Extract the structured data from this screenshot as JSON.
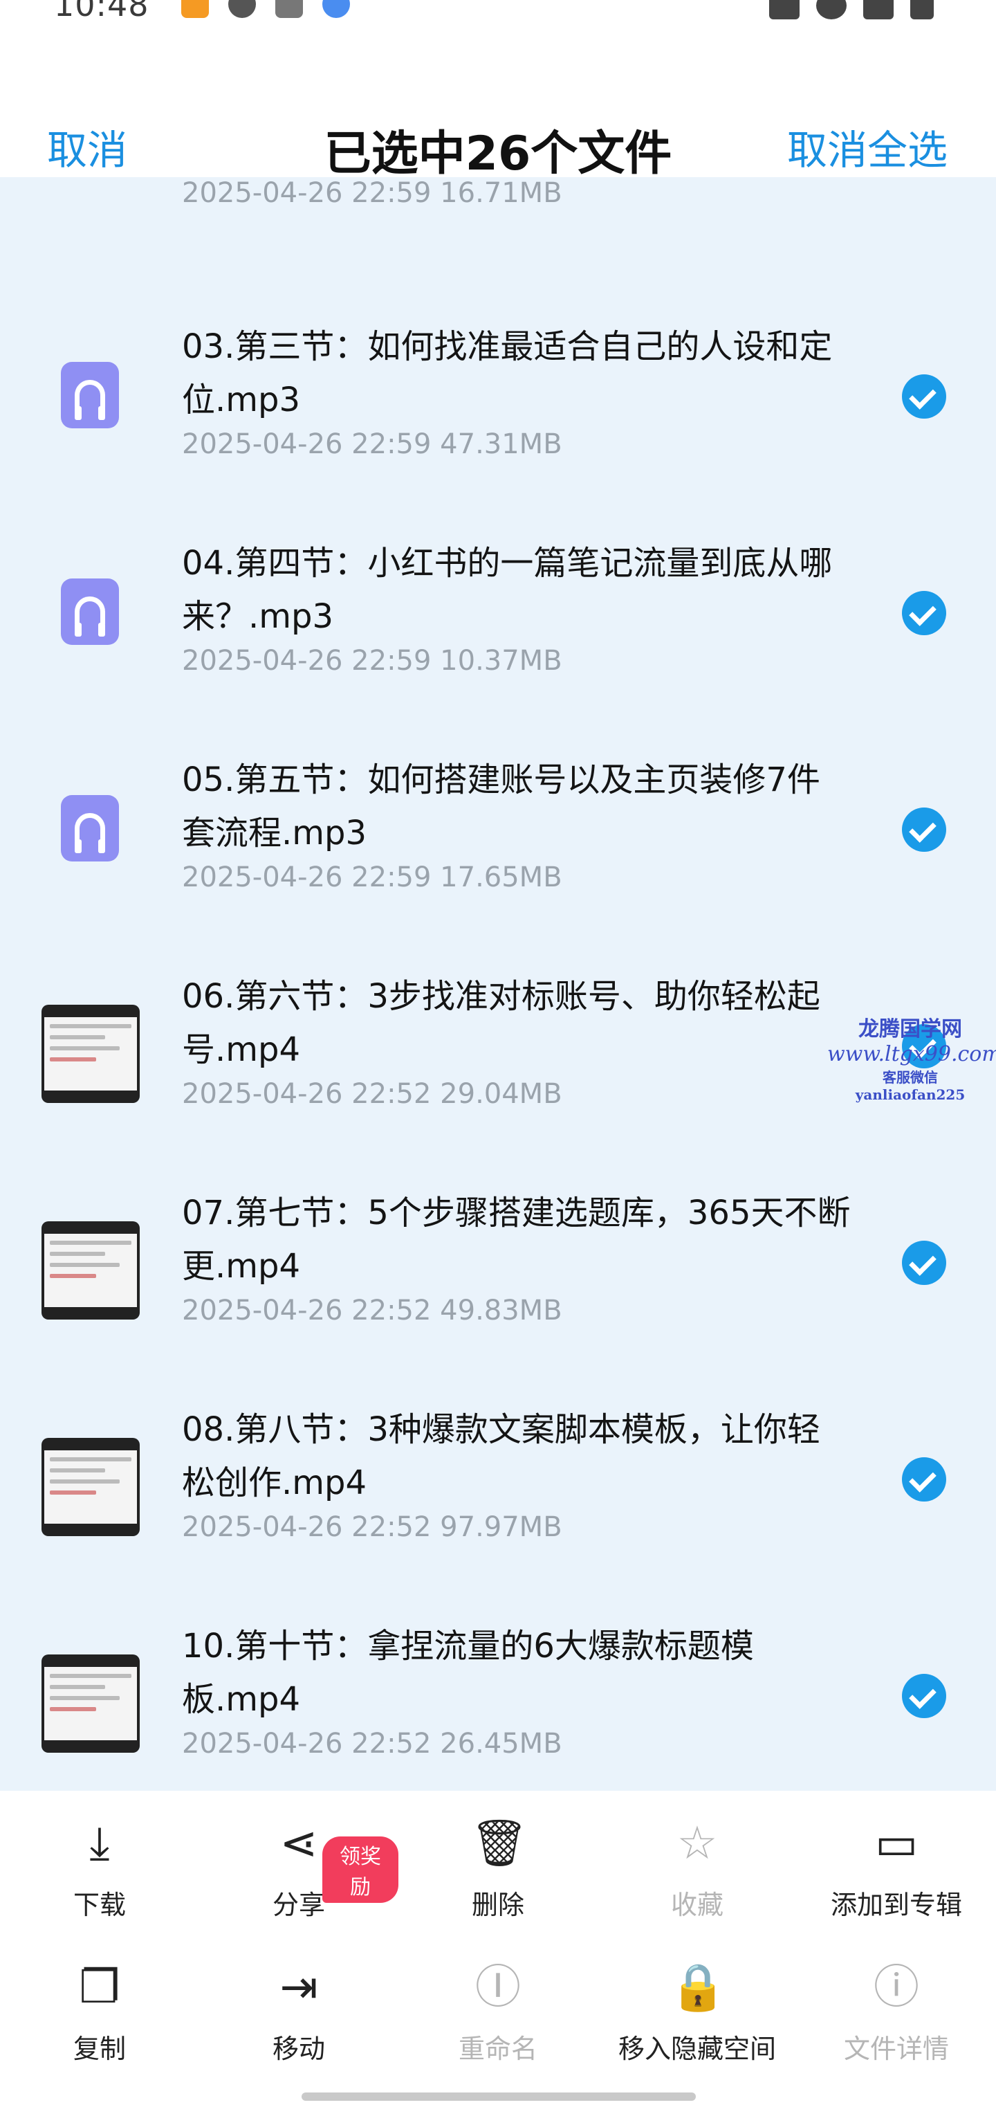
{
  "status_bar": {
    "time": "10:48"
  },
  "header": {
    "cancel": "取消",
    "title": "已选中26个文件",
    "cancel_all": "取消全选"
  },
  "previous_item_meta": "2025-04-26  22:59  16.71MB",
  "files": [
    {
      "name": "03.第三节：如何找准最适合自己的人设和定位.mp3",
      "meta": "2025-04-26  22:59  47.31MB",
      "type": "audio"
    },
    {
      "name": "04.第四节：小红书的一篇笔记流量到底从哪来？.mp3",
      "meta": "2025-04-26  22:59  10.37MB",
      "type": "audio"
    },
    {
      "name": "05.第五节：如何搭建账号以及主页装修7件套流程.mp3",
      "meta": "2025-04-26  22:59  17.65MB",
      "type": "audio"
    },
    {
      "name": "06.第六节：3步找准对标账号、助你轻松起号.mp4",
      "meta": "2025-04-26  22:52  29.04MB",
      "type": "video"
    },
    {
      "name": "07.第七节：5个步骤搭建选题库，365天不断更.mp4",
      "meta": "2025-04-26  22:52  49.83MB",
      "type": "video"
    },
    {
      "name": "08.第八节：3种爆款文案脚本模板，让你轻松创作.mp4",
      "meta": "2025-04-26  22:52  97.97MB",
      "type": "video"
    },
    {
      "name": "10.第十节：拿捏流量的6大爆款标题模板.mp4",
      "meta": "2025-04-26  22:52  26.45MB",
      "type": "video"
    }
  ],
  "watermark": {
    "line1": "龙腾国学网",
    "line2": "www.ltgx99.com",
    "line3": "客服微信 yanliaofan225"
  },
  "toolbar": {
    "download": "下载",
    "share": "分享",
    "share_badge": "领奖励",
    "delete": "删除",
    "favorite": "收藏",
    "add_to_album": "添加到专辑",
    "copy": "复制",
    "move": "移动",
    "rename": "重命名",
    "move_to_hidden": "移入隐藏空间",
    "file_details": "文件详情"
  },
  "colors": {
    "accent": "#1a9be8",
    "list_bg": "#eaf3fb",
    "audio_icon": "#8f8ff3",
    "badge": "#f23d5c"
  }
}
